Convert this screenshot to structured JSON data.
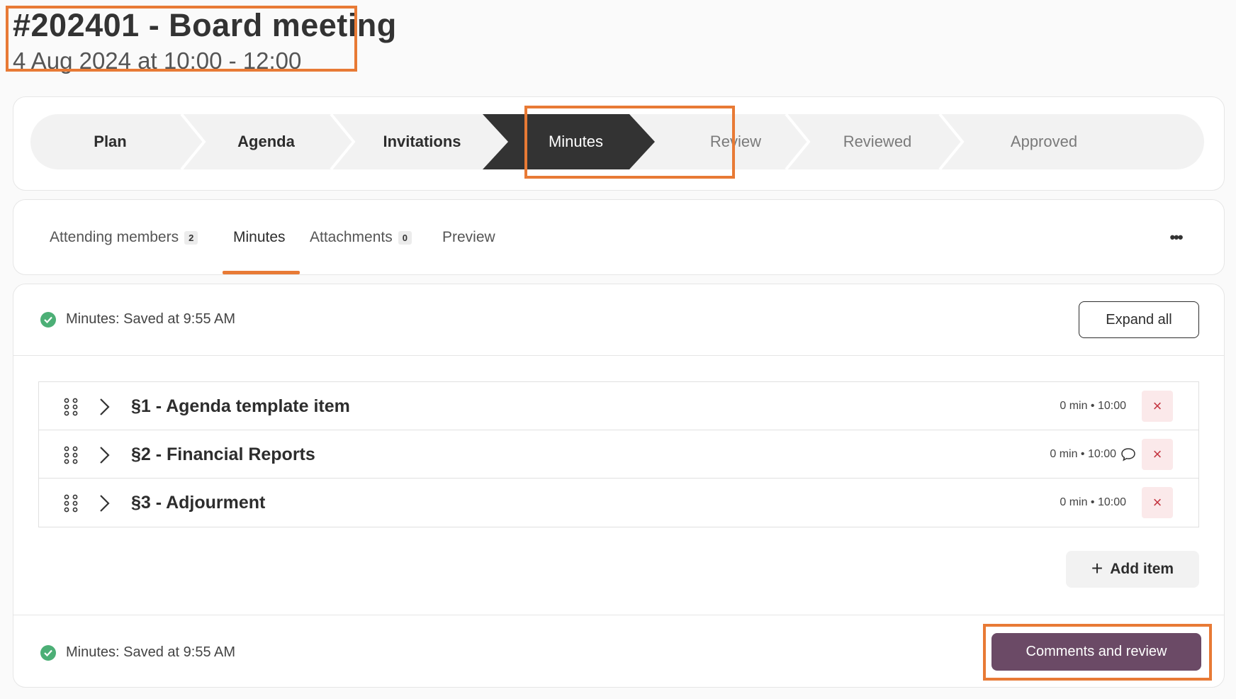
{
  "header": {
    "title": "#202401 - Board meeting",
    "subtitle": "4 Aug 2024 at 10:00 - 12:00"
  },
  "stepper": {
    "steps": [
      {
        "label": "Plan",
        "state": "done"
      },
      {
        "label": "Agenda",
        "state": "done"
      },
      {
        "label": "Invitations",
        "state": "done"
      },
      {
        "label": "Minutes",
        "state": "active"
      },
      {
        "label": "Review",
        "state": "future"
      },
      {
        "label": "Reviewed",
        "state": "future"
      },
      {
        "label": "Approved",
        "state": "future"
      }
    ]
  },
  "tabs": {
    "items": [
      {
        "label": "Attending members",
        "count": "2"
      },
      {
        "label": "Minutes"
      },
      {
        "label": "Attachments",
        "count": "0"
      },
      {
        "label": "Preview"
      }
    ],
    "active": "Minutes",
    "more_label": "•••"
  },
  "minutes": {
    "status_top": "Minutes: Saved at 9:55 AM",
    "expand_all_label": "Expand all",
    "items": [
      {
        "title": "§1 - Agenda template item",
        "meta": "0 min • 10:00",
        "has_comment": false
      },
      {
        "title": "§2 - Financial Reports",
        "meta": "0 min • 10:00",
        "has_comment": true
      },
      {
        "title": "§3 - Adjourment",
        "meta": "0 min • 10:00",
        "has_comment": false
      }
    ],
    "delete_label": "×",
    "add_item_label": "Add item",
    "add_icon": "+",
    "status_bottom": "Minutes: Saved at 9:55 AM",
    "review_button_label": "Comments and review"
  },
  "colors": {
    "accent": "#e87a35",
    "primary_button": "#6b4a66",
    "active_step": "#333333",
    "success": "#4caf76",
    "danger": "#c43540"
  }
}
